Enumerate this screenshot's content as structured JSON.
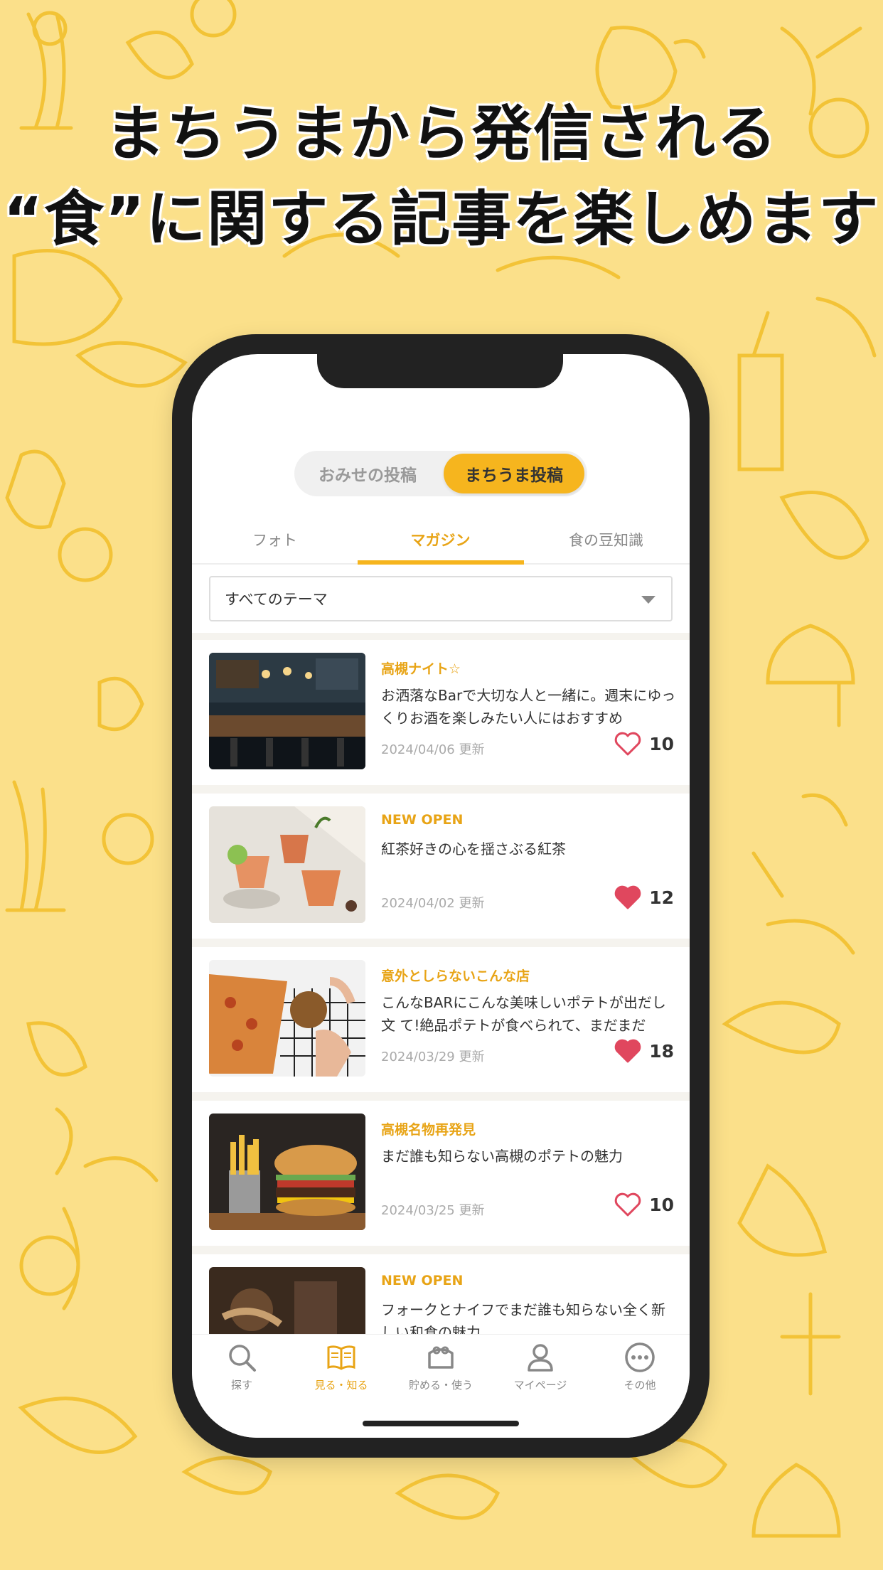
{
  "colors": {
    "background": "#fbe08a",
    "accent": "#f6b51e",
    "accent_text": "#e8a416",
    "heart": "#e0475e"
  },
  "headline": {
    "line1": "まちうまから発信される",
    "line2": "“食”に関する記事を楽しめます"
  },
  "segment": {
    "left": "おみせの投稿",
    "right": "まちうま投稿",
    "selected": "まちうま投稿"
  },
  "tabs": [
    {
      "label": "フォト"
    },
    {
      "label": "マガジン"
    },
    {
      "label": "食の豆知識"
    }
  ],
  "active_tab": "マガジン",
  "theme_select": {
    "value": "すべてのテーマ",
    "icon": "caret-down-icon"
  },
  "articles": [
    {
      "tag": "高槻ナイト☆",
      "title": "お洒落なBarで大切な人と一緒に。週末にゆっくりお酒を楽しみたい人にはおすすめ",
      "date": "2024/04/06 更新",
      "likes": "10",
      "liked": false
    },
    {
      "tag": "NEW OPEN",
      "title": "紅茶好きの心を揺さぶる紅茶",
      "date": "2024/04/02 更新",
      "likes": "12",
      "liked": true
    },
    {
      "tag": "意外としらないこんな店",
      "title": "こんなBARにこんな美味しいポテトが出だし文 て!絶品ポテトが食べられて、まだまだ",
      "date": "2024/03/29 更新",
      "likes": "18",
      "liked": true
    },
    {
      "tag": "高槻名物再発見",
      "title": "まだ誰も知らない高槻のポテトの魅力",
      "date": "2024/03/25 更新",
      "likes": "10",
      "liked": false
    },
    {
      "tag": "NEW OPEN",
      "title": "フォークとナイフでまだ誰も知らない全く新しい和食の魅力",
      "date": "",
      "likes": "",
      "liked": false
    }
  ],
  "bottom_nav": [
    {
      "label": "探す",
      "icon": "search-icon"
    },
    {
      "label": "見る・知る",
      "icon": "book-icon"
    },
    {
      "label": "貯める・使う",
      "icon": "wallet-icon"
    },
    {
      "label": "マイページ",
      "icon": "person-icon"
    },
    {
      "label": "その他",
      "icon": "more-icon"
    }
  ],
  "active_nav": "見る・知る"
}
